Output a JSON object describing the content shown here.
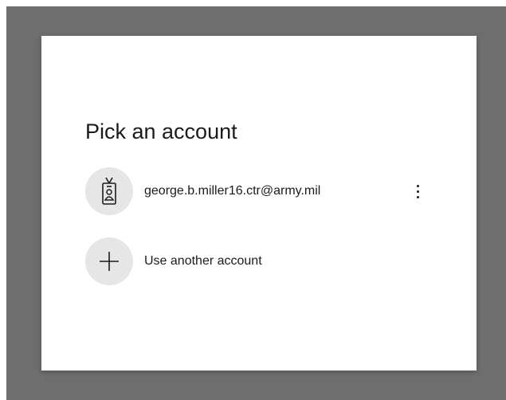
{
  "dialog": {
    "title": "Pick an account",
    "accounts": [
      {
        "email": "george.b.miller16.ctr@army.mil",
        "icon": "id-badge-icon",
        "options_icon": "more-vertical-icon"
      }
    ],
    "another_account": {
      "label": "Use another account",
      "icon": "plus-icon"
    }
  },
  "colors": {
    "backdrop": "#6e6e6e",
    "dialog_background": "#ffffff",
    "avatar_background": "#e6e6e6",
    "text": "#1b1b1b"
  }
}
